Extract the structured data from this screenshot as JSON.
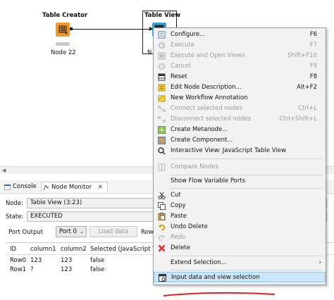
{
  "canvas": {
    "nodes": [
      {
        "title": "Table Creator",
        "label": "Node 22"
      },
      {
        "title": "Table View",
        "label": "N"
      }
    ]
  },
  "tabs": [
    {
      "label": "Console"
    },
    {
      "label": "Node Monitor"
    }
  ],
  "monitor": {
    "node_label": "Node:",
    "node_value": "Table View  (3:23)",
    "state_label": "State:",
    "state_value": "EXECUTED",
    "port_output_label": "Port Output",
    "port_select": "Port 0",
    "load_button": "Load data",
    "rows_label": "Row",
    "columns": [
      "ID",
      "column1",
      "column2",
      "Selected (JavaScript Table"
    ],
    "rows": [
      [
        "Row0",
        "123",
        "123",
        "false"
      ],
      [
        "Row1",
        "?",
        "123",
        "false"
      ]
    ]
  },
  "menu": {
    "items": [
      {
        "label": "Configure...",
        "shortcut": "F6",
        "icon": "configure-icon",
        "enabled": true
      },
      {
        "label": "Execute",
        "shortcut": "F7",
        "icon": "execute-icon",
        "enabled": false
      },
      {
        "label": "Execute and Open Views",
        "shortcut": "Shift+F10",
        "icon": "execute-open-views-icon",
        "enabled": false
      },
      {
        "label": "Cancel",
        "shortcut": "F9",
        "icon": "cancel-icon",
        "enabled": false
      },
      {
        "label": "Reset",
        "shortcut": "F8",
        "icon": "reset-icon",
        "enabled": true
      },
      {
        "label": "Edit Node Description...",
        "shortcut": "Alt+F2",
        "icon": "edit-description-icon",
        "enabled": true
      },
      {
        "label": "New Workflow Annotation",
        "shortcut": "",
        "icon": "annotation-icon",
        "enabled": true
      },
      {
        "label": "Connect selected nodes",
        "shortcut": "Ctrl+L",
        "icon": "connect-nodes-icon",
        "enabled": false
      },
      {
        "label": "Disconnect selected nodes",
        "shortcut": "Ctrl+Shift+L",
        "icon": "disconnect-nodes-icon",
        "enabled": false
      },
      {
        "label": "Create Metanode...",
        "shortcut": "",
        "icon": "metanode-icon",
        "enabled": true
      },
      {
        "label": "Create Component...",
        "shortcut": "",
        "icon": "component-icon",
        "enabled": true
      },
      {
        "label": "Interactive View: JavaScript Table View",
        "shortcut": "",
        "icon": "interactive-view-icon",
        "enabled": true
      },
      {
        "label": "Compare Nodes",
        "shortcut": "",
        "icon": "compare-nodes-icon",
        "enabled": false
      },
      {
        "label": "Show Flow Variable Ports",
        "shortcut": "",
        "icon": "",
        "enabled": true
      },
      {
        "label": "Cut",
        "shortcut": "",
        "icon": "cut-icon",
        "enabled": true
      },
      {
        "label": "Copy",
        "shortcut": "",
        "icon": "copy-icon",
        "enabled": true
      },
      {
        "label": "Paste",
        "shortcut": "",
        "icon": "paste-icon",
        "enabled": true
      },
      {
        "label": "Undo Delete",
        "shortcut": "",
        "icon": "undo-icon",
        "enabled": true
      },
      {
        "label": "Redo",
        "shortcut": "",
        "icon": "redo-icon",
        "enabled": false
      },
      {
        "label": "Delete",
        "shortcut": "",
        "icon": "delete-icon",
        "enabled": true
      },
      {
        "label": "Extend Selection...",
        "shortcut": "",
        "icon": "",
        "enabled": true,
        "submenu": true
      },
      {
        "label": "Input data and view selection",
        "shortcut": "",
        "icon": "input-data-view-icon",
        "enabled": true,
        "highlighted": true
      }
    ]
  },
  "colors": {
    "table_creator_node": "#f39a2b",
    "table_view_node": "#3aa0d8",
    "menu_highlight": "#cce4f7",
    "annotation_stroke": "#e02020"
  }
}
